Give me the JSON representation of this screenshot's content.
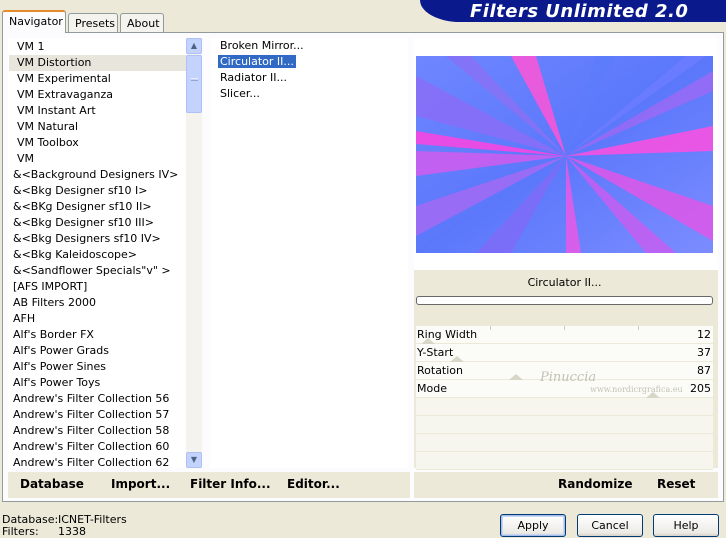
{
  "tabs": [
    {
      "label": "Navigator"
    },
    {
      "label": "Presets"
    },
    {
      "label": "About"
    }
  ],
  "banner_title": "Filters Unlimited 2.0",
  "categories": [
    {
      "label": "VM 1"
    },
    {
      "label": "VM Distortion"
    },
    {
      "label": "VM Experimental"
    },
    {
      "label": "VM Extravaganza"
    },
    {
      "label": "VM Instant Art"
    },
    {
      "label": "VM Natural"
    },
    {
      "label": "VM Toolbox"
    },
    {
      "label": "VM"
    },
    {
      "label": "&<Background Designers IV>"
    },
    {
      "label": "&<Bkg Designer sf10 I>"
    },
    {
      "label": "&<BKg Designer sf10 II>"
    },
    {
      "label": "&<Bkg Designer sf10 III>"
    },
    {
      "label": "&<Bkg Designers sf10 IV>"
    },
    {
      "label": "&<Bkg Kaleidoscope>"
    },
    {
      "label": "&<Sandflower Specials\"v\" >"
    },
    {
      "label": "[AFS IMPORT]"
    },
    {
      "label": "AB Filters 2000"
    },
    {
      "label": "AFH"
    },
    {
      "label": "Alf's Border FX"
    },
    {
      "label": "Alf's Power Grads"
    },
    {
      "label": "Alf's Power Sines"
    },
    {
      "label": "Alf's Power Toys"
    },
    {
      "label": "Andrew's Filter Collection 56"
    },
    {
      "label": "Andrew's Filter Collection 57"
    },
    {
      "label": "Andrew's Filter Collection 58"
    },
    {
      "label": "Andrew's Filter Collection 60"
    },
    {
      "label": "Andrew's Filter Collection 62"
    }
  ],
  "filters": [
    {
      "label": "Broken Mirror..."
    },
    {
      "label": "Circulator II..."
    },
    {
      "label": "Radiator II..."
    },
    {
      "label": "Slicer..."
    }
  ],
  "preview": {
    "filter_name": "Circulator II..."
  },
  "params": [
    {
      "name": "Ring Width",
      "value": "12"
    },
    {
      "name": "Y-Start",
      "value": "37"
    },
    {
      "name": "Rotation",
      "value": "87"
    },
    {
      "name": "Mode",
      "value": "205"
    }
  ],
  "watermark": {
    "line1": "Pinuccia",
    "line2": "www.nordicrgrafica.eu"
  },
  "bottom_links": {
    "database": "Database",
    "import": "Import...",
    "filter_info": "Filter Info...",
    "editor": "Editor...",
    "randomize": "Randomize",
    "reset": "Reset"
  },
  "status": {
    "database_label": "Database:",
    "database_value": "ICNET-Filters",
    "filters_label": "Filters:",
    "filters_value": "1338"
  },
  "buttons": {
    "apply": "Apply",
    "cancel": "Cancel",
    "help": "Help"
  },
  "colors": {
    "banner": "#0a1a8c",
    "selection": "#316ac5",
    "tab_accent": "#e68b2c"
  }
}
